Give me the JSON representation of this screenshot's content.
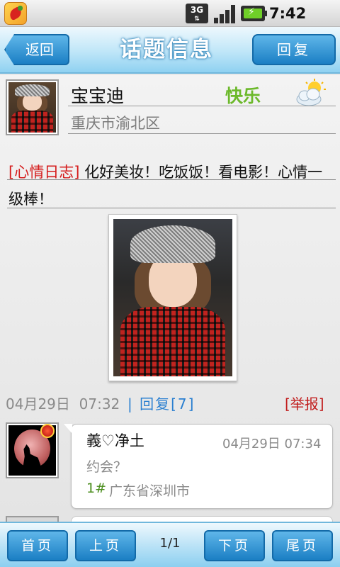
{
  "status_bar": {
    "network": "3G",
    "time": "7:42 AM",
    "icons": [
      "app-pepper-icon",
      "3g-icon",
      "signal-icon",
      "battery-charging-icon"
    ]
  },
  "header": {
    "back_label": "返回",
    "title": "话题信息",
    "reply_label": "回复"
  },
  "topic": {
    "author": "宝宝迪",
    "mood": "快乐",
    "weather_icon": "sunny-cloud-icon",
    "location": "重庆市渝北区",
    "tag": "[心情日志]",
    "body": "化好美妆！吃饭饭！看电影！心情一级棒！",
    "date": "04月29日",
    "time": "07:32",
    "separator": "|",
    "reply_link": "回复[7]",
    "report": "[举报]"
  },
  "comments": [
    {
      "name": "義♡净土",
      "time": "04月29日 07:34",
      "text": "约会？",
      "floor": "1#",
      "location": "广东省深圳市"
    }
  ],
  "footer": {
    "first": "首页",
    "prev": "上页",
    "page": "1/1",
    "next": "下页",
    "last": "尾页"
  },
  "colors": {
    "accent_blue": "#1b7fc4",
    "tag_red": "#d51e1e",
    "mood_green": "#6cb92b",
    "floor_green": "#4a8d1c",
    "link_blue": "#2a7fd0"
  }
}
